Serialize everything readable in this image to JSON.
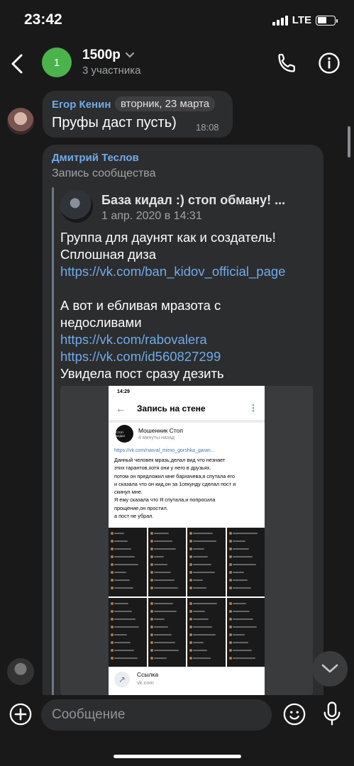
{
  "status_bar": {
    "time": "23:42",
    "network": "LTE"
  },
  "header": {
    "avatar_text": "1",
    "title": "1500р",
    "subtitle": "3 участника",
    "colors": {
      "avatar": "#4bb34b"
    }
  },
  "messages": [
    {
      "sender": "Егор Кенин",
      "date_pill": "вторник, 23 марта",
      "text": "Пруфы даст пусть)",
      "time": "18:08"
    },
    {
      "sender": "Дмитрий Теслов",
      "subtitle": "Запись сообщества",
      "repost": {
        "author": "База кидал :) стоп обману! ...",
        "date": "1 апр. 2020 в 14:31",
        "line1": "Группа для даунят как и создатель!",
        "line2": "Сплошная диза",
        "link1": "https://vk.com/ban_kidov_official_page",
        "line3": "А вот и ебливая мразота с",
        "line4": "недосливами",
        "link2": "https://vk.com/rabovalera",
        "link3": "https://vk.com/id560827299",
        "line5": "Увидела пост сразу дезить",
        "screenshot": {
          "time": "14:29",
          "header": "Запись на стене",
          "avatar_text": "СТОП КИДАЛ",
          "author": "Мошенник Стоп",
          "ago": "4 минуты назад",
          "link": "https://vk.com/nasral_mimo_gorshka_garan...",
          "body": [
            "Данный человек мразь,делал вид что незнает",
            "этих гарантов,хотя они у него в друзьях.",
            "потом он предложил мне бархачева,я спутала его",
            "и сказала что он кид,он за 1секунду сделал пост и",
            "скинул мне.",
            "Я ему сказала что Я спутала,и попросила",
            "прощение,он простил.",
            "а пост не убрал."
          ],
          "link_title": "Ссылка",
          "link_url": "vk.com"
        }
      }
    }
  ],
  "input": {
    "placeholder": "Сообщение"
  },
  "icons": [
    "back-arrow-icon",
    "chevron-down-icon",
    "phone-icon",
    "info-icon",
    "plus-icon",
    "emoji-icon",
    "mic-icon",
    "chevron-down-icon"
  ]
}
